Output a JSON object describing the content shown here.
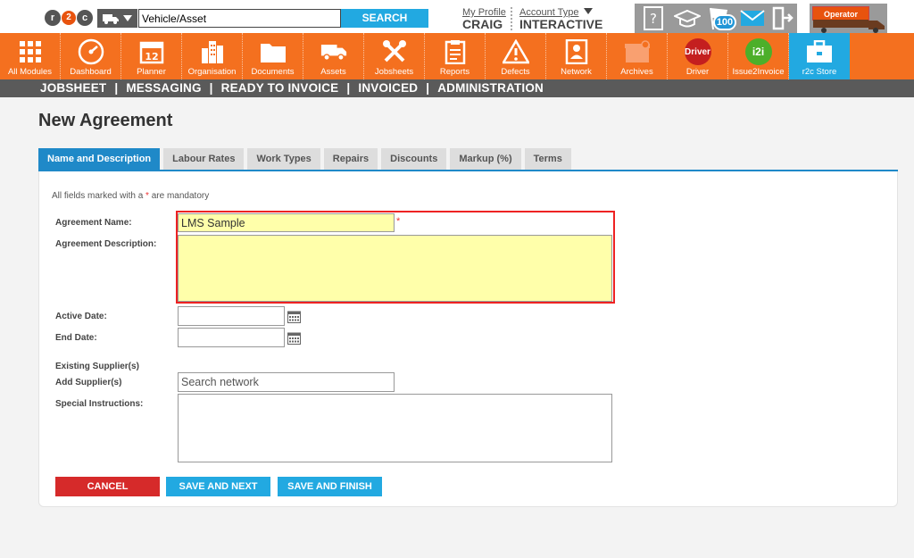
{
  "topbar": {
    "logo_text": [
      "r",
      "2",
      "c"
    ],
    "search_value": "Vehicle/Asset",
    "search_button": "SEARCH",
    "profile_link": "My Profile",
    "profile_name": "CRAIG",
    "account_link": "Account Type",
    "account_value": "INTERACTIVE",
    "badge_count": "100",
    "operator_label": "Operator"
  },
  "modules": [
    {
      "label": "All Modules",
      "icon": "grid-icon"
    },
    {
      "label": "Dashboard",
      "icon": "speedometer-icon"
    },
    {
      "label": "Planner",
      "icon": "calendar-icon",
      "day": "12"
    },
    {
      "label": "Organisation",
      "icon": "building-icon"
    },
    {
      "label": "Documents",
      "icon": "folder-icon"
    },
    {
      "label": "Assets",
      "icon": "truck-icon"
    },
    {
      "label": "Jobsheets",
      "icon": "tools-icon"
    },
    {
      "label": "Reports",
      "icon": "clipboard-icon"
    },
    {
      "label": "Defects",
      "icon": "warning-icon"
    },
    {
      "label": "Network",
      "icon": "contact-card-icon"
    },
    {
      "label": "Archives",
      "icon": "archive-box-icon"
    },
    {
      "label": "Driver",
      "icon": "driver-logo-icon",
      "logo": "Driver"
    },
    {
      "label": "Issue2Invoice",
      "icon": "i2i-logo-icon",
      "logo": "i2i"
    },
    {
      "label": "r2c Store",
      "icon": "briefcase-icon"
    }
  ],
  "subnav": [
    "JOBSHEET",
    "MESSAGING",
    "READY TO INVOICE",
    "INVOICED",
    "ADMINISTRATION"
  ],
  "page": {
    "title": "New Agreement",
    "tabs": [
      "Name and Description",
      "Labour Rates",
      "Work Types",
      "Repairs",
      "Discounts",
      "Markup (%)",
      "Terms"
    ],
    "mandatory_note": "All fields marked with a",
    "mandatory_star": "*",
    "mandatory_suffix": "are mandatory"
  },
  "form": {
    "agreement_name_label": "Agreement Name:",
    "agreement_name_value": "LMS Sample",
    "agreement_description_label": "Agreement Description:",
    "agreement_description_value": "",
    "active_date_label": "Active Date:",
    "active_date_value": "",
    "end_date_label": "End Date:",
    "end_date_value": "",
    "existing_suppliers_label": "Existing Supplier(s)",
    "add_suppliers_label": "Add Supplier(s)",
    "add_suppliers_placeholder": "Search network",
    "special_instructions_label": "Special Instructions:",
    "special_instructions_value": ""
  },
  "buttons": {
    "cancel": "CANCEL",
    "save_next": "SAVE AND NEXT",
    "save_finish": "SAVE AND FINISH"
  },
  "colors": {
    "orange": "#f4701f",
    "blue": "#22a9e1",
    "tab_active": "#1f89c8",
    "cancel_red": "#d62a2a",
    "highlight_red": "#e22222",
    "field_yellow": "#ffffaa"
  }
}
